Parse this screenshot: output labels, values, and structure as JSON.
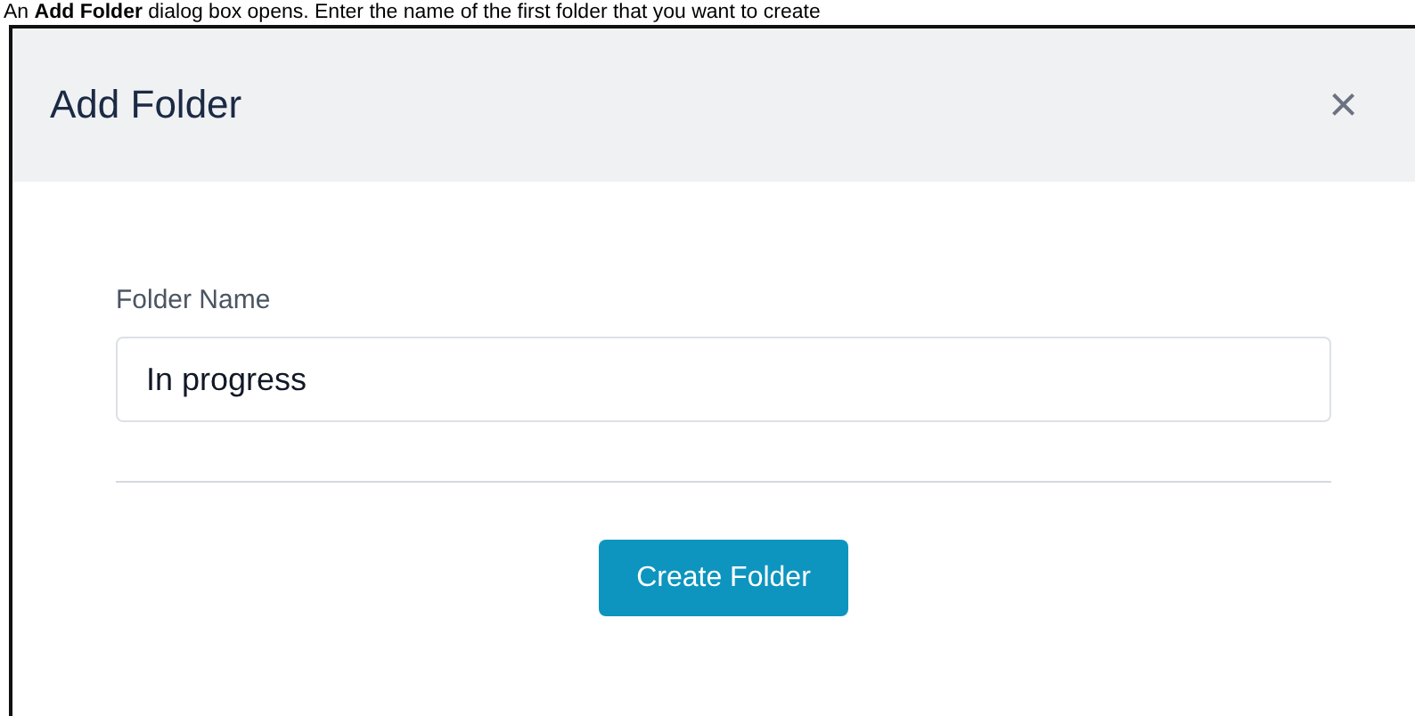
{
  "caption": "An **Add Folder** dialog box opens. Enter the name of the first folder that you want to create",
  "dialog": {
    "title": "Add Folder",
    "close": "×",
    "field": {
      "label": "Folder Name",
      "value": "In progress"
    },
    "button": "Create Folder"
  }
}
